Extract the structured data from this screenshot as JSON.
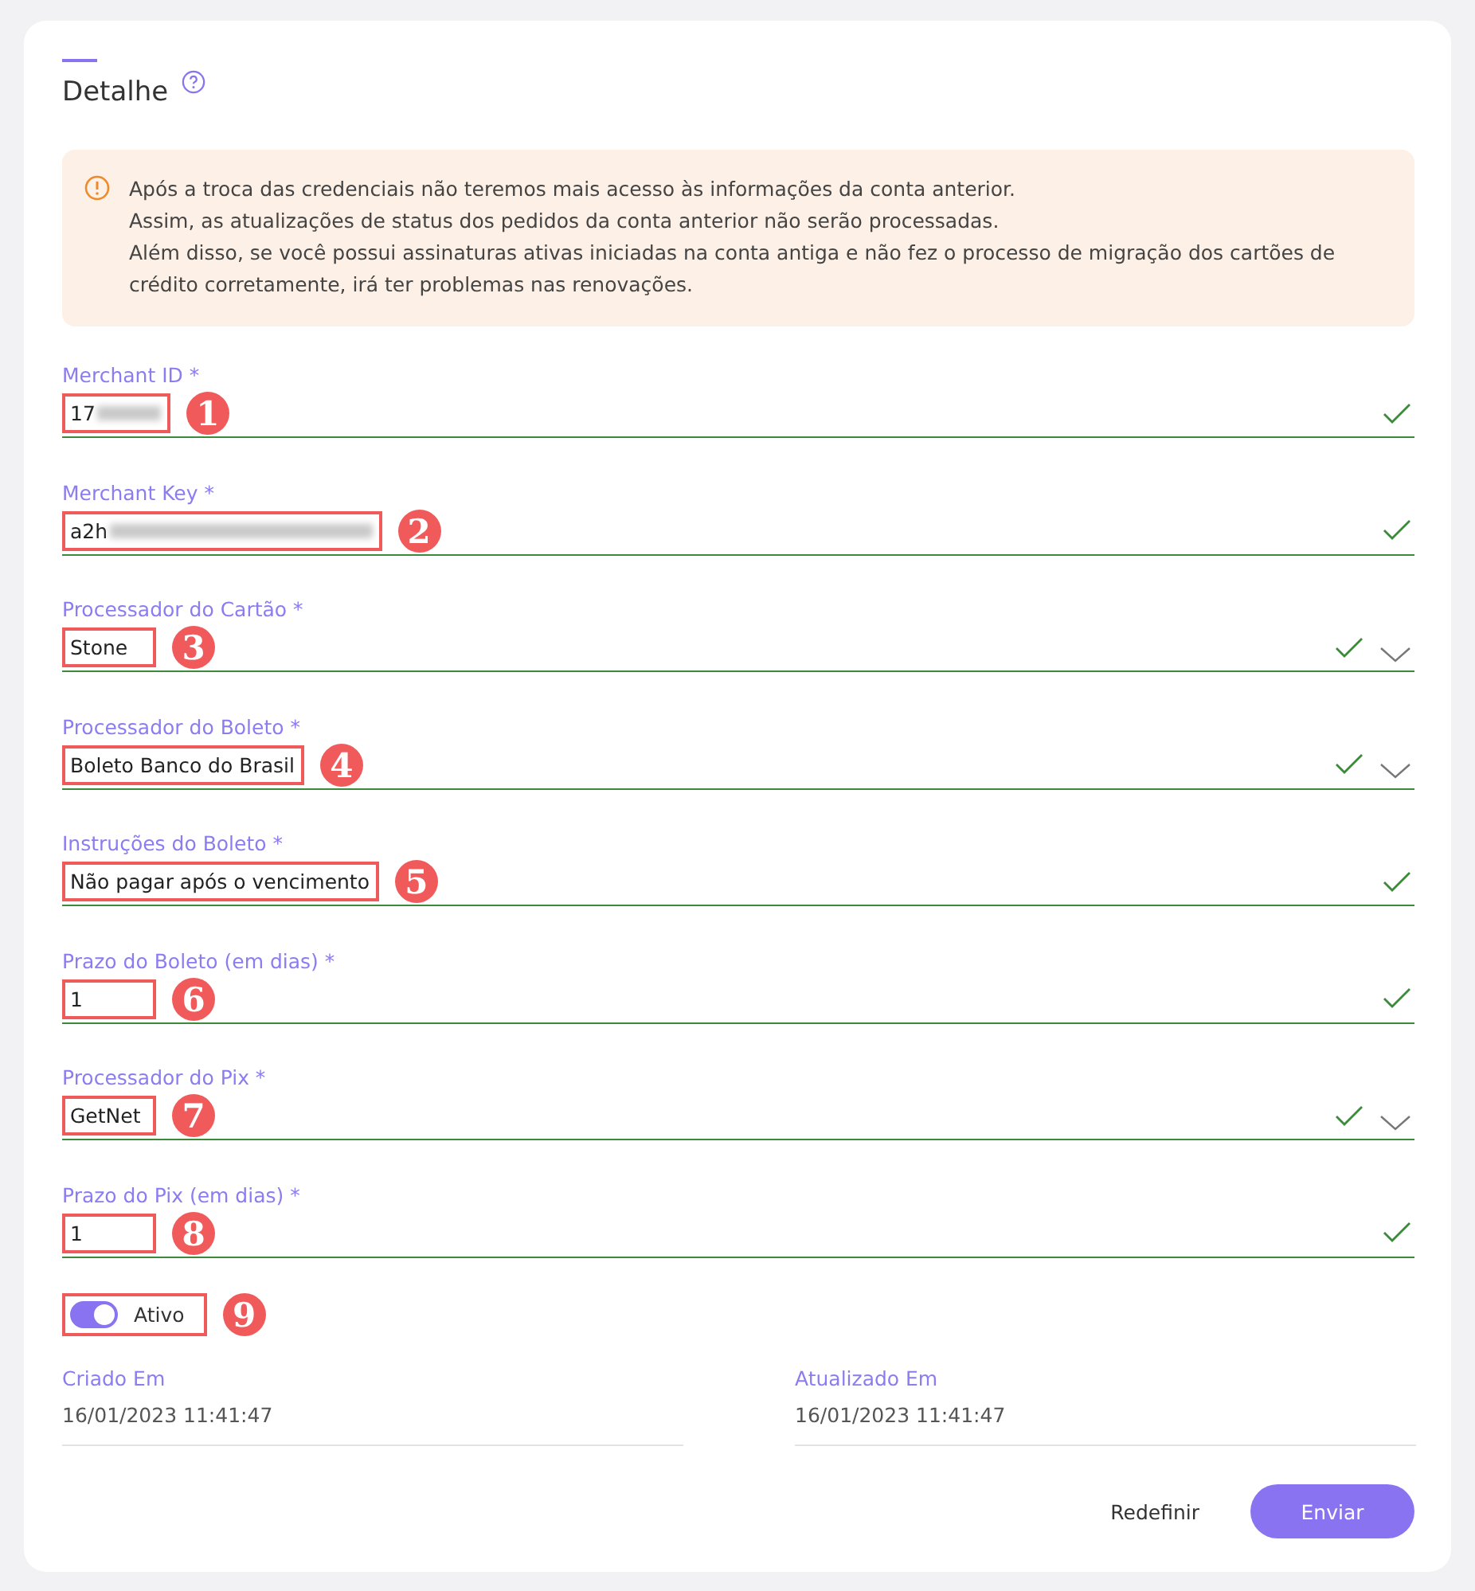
{
  "header": {
    "title": "Detalhe"
  },
  "alert": {
    "lines": [
      "Após a troca das credenciais não teremos mais acesso às informações da conta anterior.",
      "Assim, as atualizações de status dos pedidos da conta anterior não serão processadas.",
      "Além disso, se você possui assinaturas ativas iniciadas na conta antiga e não fez o processo de migração dos cartões de crédito corretamente, irá ter problemas nas renovações."
    ]
  },
  "fields": [
    {
      "label": "Merchant ID *",
      "value": "17",
      "kind": "text",
      "valid": true,
      "redacted": true,
      "marker": "1"
    },
    {
      "label": "Merchant Key *",
      "value": "a2h",
      "kind": "text",
      "valid": true,
      "redacted": true,
      "marker": "2"
    },
    {
      "label": "Processador do Cartão *",
      "value": "Stone",
      "kind": "select",
      "valid": true,
      "redacted": false,
      "marker": "3"
    },
    {
      "label": "Processador do Boleto *",
      "value": "Boleto Banco do Brasil",
      "kind": "select",
      "valid": true,
      "redacted": false,
      "marker": "4"
    },
    {
      "label": "Instruções do Boleto *",
      "value": "Não pagar após o vencimento",
      "kind": "text",
      "valid": true,
      "redacted": false,
      "marker": "5"
    },
    {
      "label": "Prazo do Boleto (em dias) *",
      "value": "1",
      "kind": "text",
      "valid": true,
      "redacted": false,
      "marker": "6"
    },
    {
      "label": "Processador do Pix *",
      "value": "GetNet",
      "kind": "select",
      "valid": true,
      "redacted": false,
      "marker": "7"
    },
    {
      "label": "Prazo do Pix (em dias) *",
      "value": "1",
      "kind": "text",
      "valid": true,
      "redacted": false,
      "marker": "8"
    }
  ],
  "toggle": {
    "label": "Ativo",
    "on": true,
    "marker": "9"
  },
  "info": [
    {
      "label": "Criado Em",
      "value": "16/01/2023 11:41:47"
    },
    {
      "label": "Atualizado Em",
      "value": "16/01/2023 11:41:47"
    }
  ],
  "buttons": [
    {
      "label": "Redefinir",
      "kind": "text"
    },
    {
      "label": "Enviar",
      "kind": "primary"
    }
  ]
}
